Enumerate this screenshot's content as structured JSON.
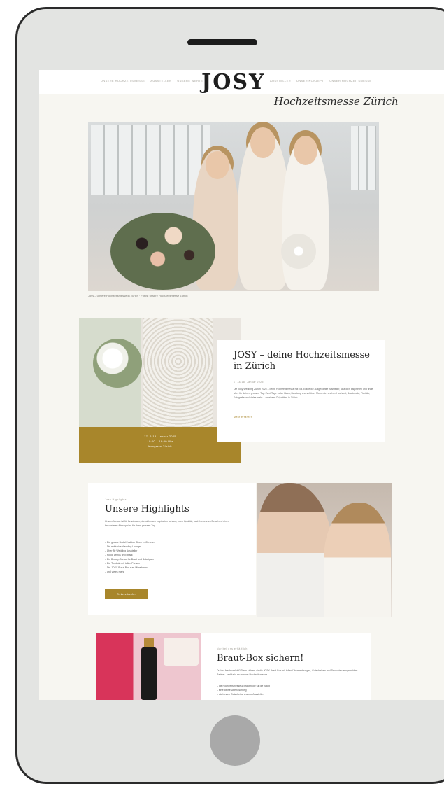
{
  "nav": {
    "left": [
      "Unsere Hochzeitsmesse",
      "Ausstellen",
      "Unsere Werte"
    ],
    "logo": "JOSY",
    "right": [
      "Aussteller",
      "Unser Konzept",
      "Unser Hochzeitsmesse"
    ]
  },
  "hero": {
    "script_title": "Hochzeitsmesse Zürich",
    "caption": "Josy – unsere Hochzeitsmesse in Zürich · Fotos: unsere Hochzeitsmesse Zürich"
  },
  "intro_card": {
    "title": "JOSY – deine Hochzeitsmesse in Zürich",
    "date": "17. & 18. Januar 2025",
    "body": "Die Josy Wedding Zürich 2025 – deine Hochzeitsmesse mit Stil. Entdecke ausgewählte Aussteller, lass dich inspirieren und finde alles für deinen grossen Tag. Zwei Tage voller Ideen, Beratung und schöner Momente rund um Hochzeit, Brautmode, Floristik, Fotografie und vieles mehr – an einem Ort, mitten in Zürich.",
    "link": "Mehr erfahren",
    "band": [
      "17. & 18. Januar 2025",
      "10:00 – 18:00 Uhr",
      "Kongress Zürich"
    ]
  },
  "highlights": {
    "eyebrow": "Josy Highlights",
    "title": "Unsere Highlights",
    "intro": "Unsere Messe ist für Brautpaare, die sich nach Inspiration sehnen, nach Qualität, nach Liebe zum Detail und einer besonderen Atmosphäre für ihren grossen Tag.",
    "items": [
      "– Die grosse Bridal Fashion Show im Zentrum",
      "– Die exklusive Wedding Lounge",
      "– Über 80 Wedding Aussteller",
      "– Food, Drinks und Musik",
      "– Ein Beauty-Corner für Braut und Bräutigam",
      "– Die Tombola mit tollen Preisen",
      "– Die JOSY Braut-Box zum Mitnehmen",
      "– und vieles mehr"
    ],
    "button": "Tickets kaufen"
  },
  "braut_box": {
    "eyebrow": "Nur bei uns erhältlich",
    "title": "Braut-Box sichern!",
    "intro": "Du bist frisch verlobt? Dann sichere dir die JOSY Braut-Box mit tollen Überraschungen, Gutscheinen und Produkten ausgewählter Partner – exklusiv an unserer Hochzeitsmesse.",
    "items": [
      "– die Hochzeitsmesse & Brautmode für die Braut",
      "– eine kleine Überraschung",
      "– die besten Gutscheine unserer Aussteller"
    ]
  }
}
